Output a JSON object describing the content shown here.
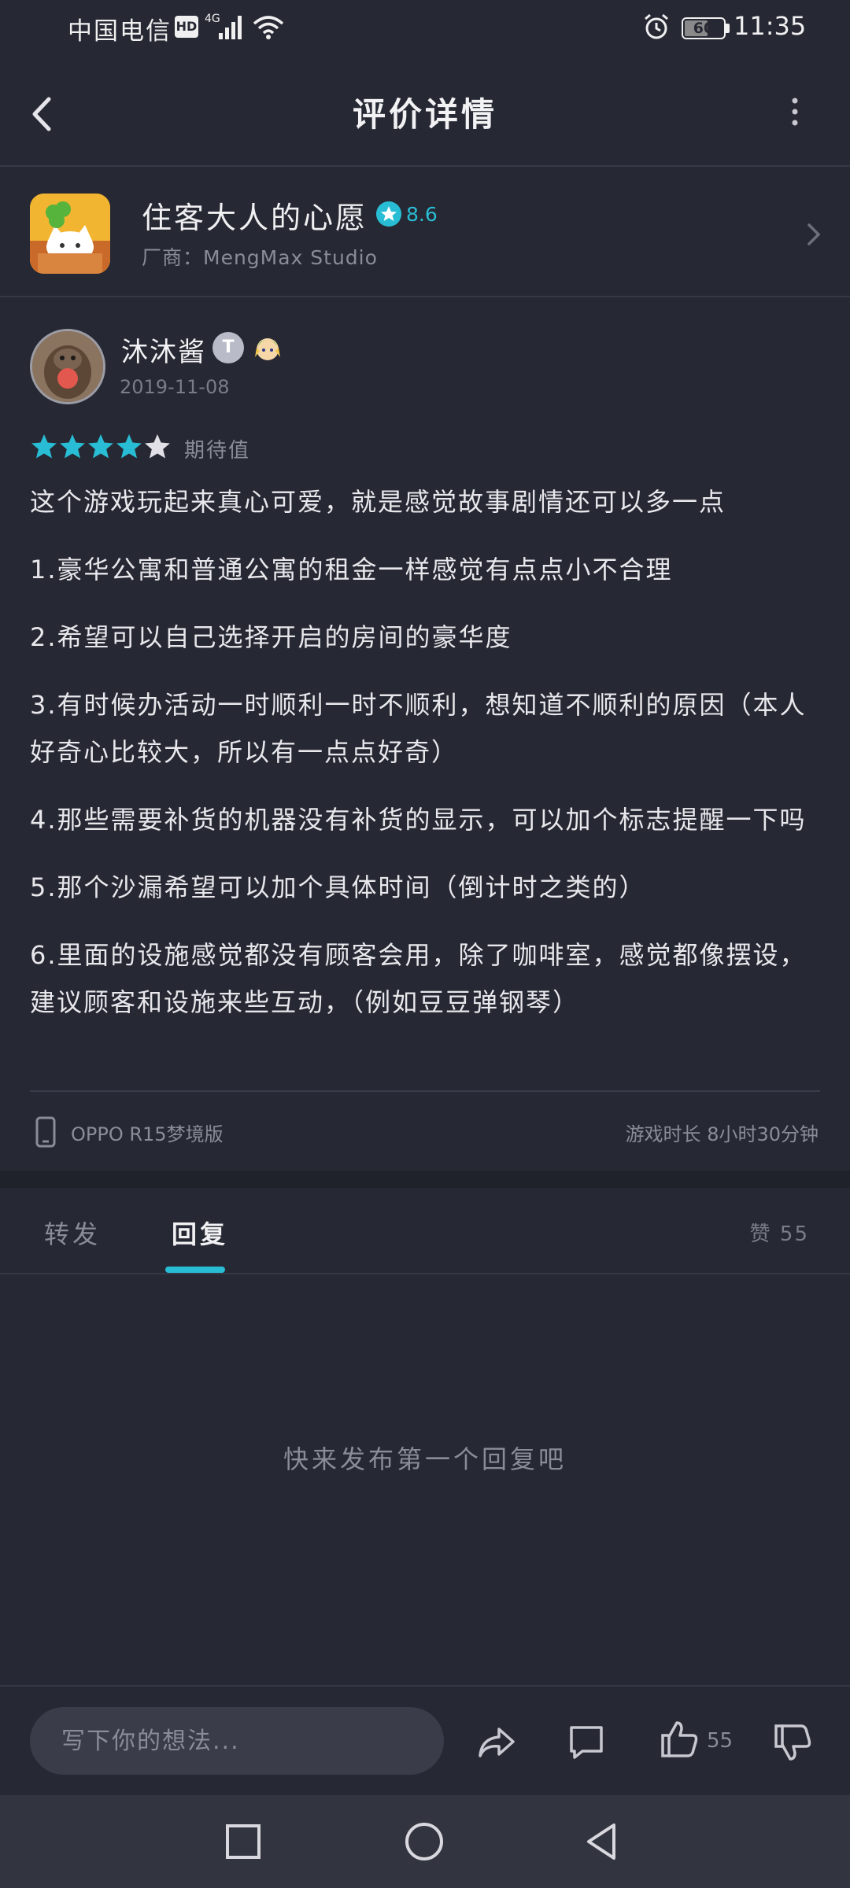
{
  "status_bar": {
    "carrier": "中国电信",
    "hd_label": "HD",
    "network": "4G",
    "battery_level": "60",
    "battery_fraction": 0.6,
    "time": "11:35"
  },
  "header": {
    "title": "评价详情"
  },
  "game": {
    "name": "住客大人的心愿",
    "score": "8.6",
    "vendor": "厂商：MengMax Studio"
  },
  "review": {
    "user_name": "沐沐酱",
    "level_badge": "T",
    "date": "2019-11-08",
    "rating": 4,
    "rating_max": 5,
    "rating_label": "期待值",
    "paragraphs": [
      "这个游戏玩起来真心可爱，就是感觉故事剧情还可以多一点",
      "1.豪华公寓和普通公寓的租金一样感觉有点点小不合理",
      "2.希望可以自己选择开启的房间的豪华度",
      "3.有时候办活动一时顺利一时不顺利，想知道不顺利的原因（本人好奇心比较大，所以有一点点好奇）",
      "4.那些需要补货的机器没有补货的显示，可以加个标志提醒一下吗",
      "5.那个沙漏希望可以加个具体时间（倒计时之类的）",
      "6.里面的设施感觉都没有顾客会用，除了咖啡室，感觉都像摆设，建议顾客和设施来些互动，（例如豆豆弹钢琴）"
    ],
    "device": "OPPO R15梦境版",
    "play_time": "游戏时长 8小时30分钟"
  },
  "tabs": {
    "forward": "转发",
    "reply": "回复",
    "likes": "赞 55"
  },
  "empty_message": "快来发布第一个回复吧",
  "action_bar": {
    "input_placeholder": "写下你的想法...",
    "like_count": "55"
  },
  "colors": {
    "background": "#262833",
    "accent": "#28bdd4",
    "muted_text": "#8a8c98"
  }
}
